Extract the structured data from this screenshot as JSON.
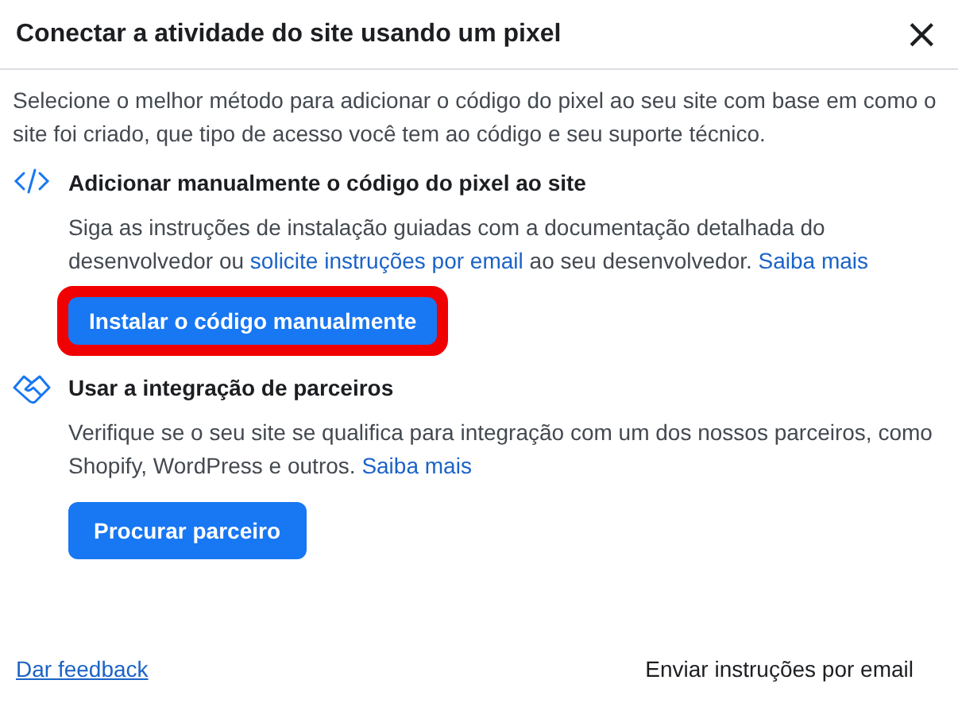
{
  "dialog": {
    "title": "Conectar a atividade do site usando um pixel",
    "close": "×"
  },
  "intro": "Selecione o melhor método para adicionar o código do pixel ao seu site com base em como o site foi criado, que tipo de acesso você tem ao código e seu suporte técnico.",
  "options": [
    {
      "kind": "code",
      "title": "Adicionar manualmente o código do pixel ao site",
      "description": [
        {
          "kind": "text",
          "text": "Siga as instruções de instalação guiadas com a documentação detalhada do desenvolvedor ou "
        },
        {
          "kind": "link",
          "text": "solicite instruções por email"
        },
        {
          "kind": "text",
          "text": " ao seu desenvolvedor. "
        },
        {
          "kind": "link",
          "text": "Saiba mais"
        }
      ],
      "button": {
        "label": "Instalar o código manualmente",
        "highlighted": true
      }
    },
    {
      "kind": "partner",
      "title": "Usar a integração de parceiros",
      "description": [
        {
          "kind": "text",
          "text": "Verifique se o seu site se qualifica para integração com um dos nossos parceiros, como Shopify, WordPress e outros. "
        },
        {
          "kind": "link",
          "text": "Saiba mais"
        }
      ],
      "button": {
        "label": "Procurar parceiro",
        "highlighted": false
      }
    }
  ],
  "footer": {
    "feedback": "Dar feedback",
    "email": "Enviar instruções por email"
  }
}
